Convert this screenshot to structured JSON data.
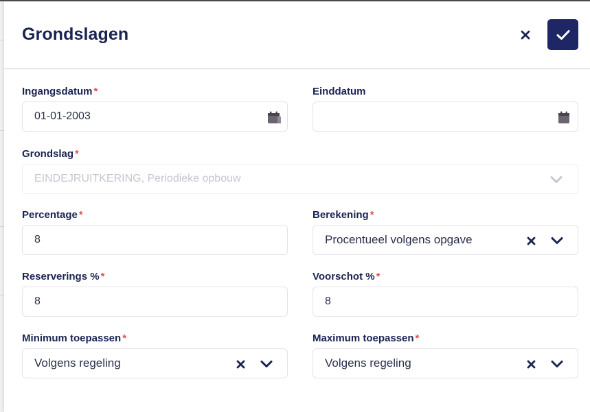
{
  "dialog": {
    "title": "Grondslagen"
  },
  "fields": {
    "ingangsdatum": {
      "label": "Ingangsdatum",
      "required": "*",
      "value": "01-01-2003"
    },
    "einddatum": {
      "label": "Einddatum",
      "value": ""
    },
    "grondslag": {
      "label": "Grondslag",
      "required": "*",
      "value": "EINDEJRUITKERING, Periodieke opbouw"
    },
    "percentage": {
      "label": "Percentage",
      "required": "*",
      "value": "8"
    },
    "berekening": {
      "label": "Berekening",
      "required": "*",
      "value": "Procentueel volgens opgave"
    },
    "reserverings": {
      "label": "Reserverings %",
      "required": "*",
      "value": "8"
    },
    "voorschot": {
      "label": "Voorschot %",
      "required": "*",
      "value": "8"
    },
    "minimum": {
      "label": "Minimum toepassen",
      "required": "*",
      "value": "Volgens regeling"
    },
    "maximum": {
      "label": "Maximum toepassen",
      "required": "*",
      "value": "Volgens regeling"
    }
  },
  "icons": {
    "close": "close-icon",
    "confirm": "checkmark-icon",
    "calendar": "calendar-icon",
    "clear": "clear-x-icon",
    "dropdown": "chevron-down-icon"
  },
  "colors": {
    "primary": "#1e2665",
    "text": "#1b2352",
    "required": "#e0524f",
    "border": "#e2e4ea",
    "disabled_text": "#c4c7d1"
  }
}
